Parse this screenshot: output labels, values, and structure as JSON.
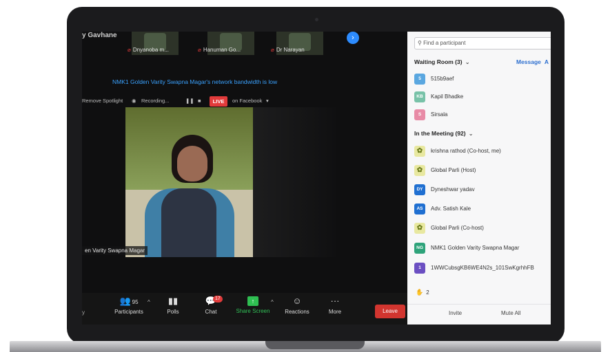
{
  "presenter_label": "y Gavhane",
  "thumbnails": [
    {
      "name": "Dnyanoba m..."
    },
    {
      "name": "Hanuman Go..."
    },
    {
      "name": "Dr Narayan"
    }
  ],
  "notification": "NMK1 Golden Varity Swapna Magar's network bandwidth is low",
  "spotlight_bar": {
    "remove_spotlight": "Remove Spotlight",
    "recording": "Recording...",
    "live": "LIVE",
    "on_facebook": "on Facebook"
  },
  "video_name": "en Varity Swapna Magar",
  "toolbar": {
    "y_fragment": "y",
    "participants_count": "95",
    "participants_label": "Participants",
    "polls_label": "Polls",
    "chat_label": "Chat",
    "chat_badge": "17",
    "share_label": "Share Screen",
    "reactions_label": "Reactions",
    "more_label": "More",
    "leave_label": "Leave"
  },
  "panel": {
    "search_placeholder": "Find a participant",
    "waiting_room_title": "Waiting Room (3)",
    "message_link": "Message",
    "message_link_extra": "A",
    "waiting": [
      {
        "initials": "5",
        "name": "515b9aef",
        "color": "#5aa7e0"
      },
      {
        "initials": "KB",
        "name": "Kapil Bhadke",
        "color": "#78c2a8"
      },
      {
        "initials": "S",
        "name": "Sirsala",
        "color": "#e88ba6"
      }
    ],
    "in_meeting_title": "In the Meeting (92)",
    "in_meeting": [
      {
        "initials": "",
        "name": "krishna rathod (Co-host, me)",
        "color": "#e8e8a0"
      },
      {
        "initials": "",
        "name": "Global Parli (Host)",
        "color": "#e8e8a0"
      },
      {
        "initials": "DY",
        "name": "Dyneshwar yadav",
        "color": "#1f6fd1"
      },
      {
        "initials": "AS",
        "name": "Adv. Satish Kale",
        "color": "#1f6fd1"
      },
      {
        "initials": "",
        "name": "Global Parli (Co-host)",
        "color": "#e8e8a0"
      },
      {
        "initials": "NG",
        "name": "NMK1 Golden Varity Swapna Magar",
        "color": "#2ea37a"
      },
      {
        "initials": "1",
        "name": "1WWCubsgKB6WE4N2s_101SwKgrhhFB",
        "color": "#6b4fc2"
      }
    ],
    "raised_hands": "2",
    "invite_label": "Invite",
    "mute_all_label": "Mute All"
  }
}
